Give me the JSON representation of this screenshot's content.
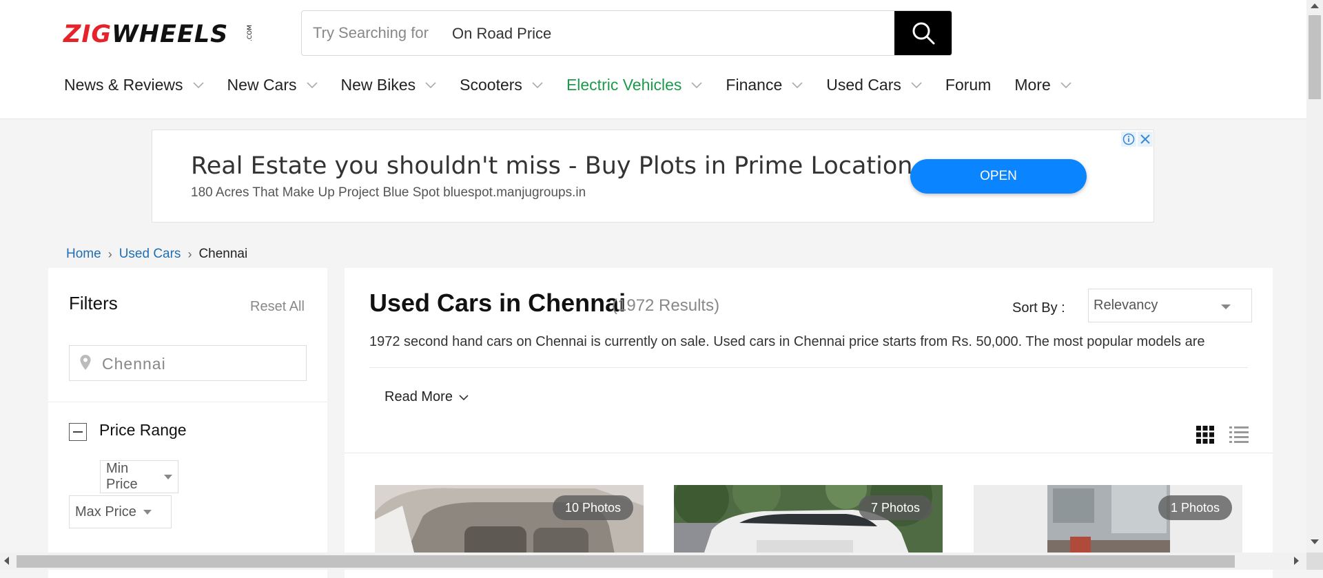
{
  "brand": {
    "logo_part1": "ZIG",
    "logo_part2": "WHEELS",
    "logo_suffix": ".COM",
    "red": "#e4232a"
  },
  "search": {
    "placeholder": "Try Searching for",
    "value": "On Road Price",
    "icon": "search-icon"
  },
  "nav": {
    "items": [
      {
        "label": "News & Reviews",
        "dropdown": true
      },
      {
        "label": "New Cars",
        "dropdown": true
      },
      {
        "label": "New Bikes",
        "dropdown": true
      },
      {
        "label": "Scooters",
        "dropdown": true
      },
      {
        "label": "Electric Vehicles",
        "dropdown": true,
        "color": "#1c9a4a"
      },
      {
        "label": "Finance",
        "dropdown": true
      },
      {
        "label": "Used Cars",
        "dropdown": true
      },
      {
        "label": "Forum",
        "dropdown": false
      },
      {
        "label": "More",
        "dropdown": true
      }
    ]
  },
  "ad": {
    "title": "Real Estate you shouldn't miss - Buy Plots in Prime Location",
    "subtitle": "180 Acres That Make Up Project Blue Spot bluespot.manjugroups.in",
    "button": "OPEN",
    "button_color": "#0a84ff"
  },
  "breadcrumb": {
    "home": "Home",
    "used": "Used Cars",
    "current": "Chennai"
  },
  "filters": {
    "title": "Filters",
    "reset": "Reset All",
    "city": "Chennai",
    "price_range": "Price Range",
    "min_price": "Min Price",
    "max_price": "Max Price"
  },
  "main": {
    "title": "Used Cars in Chennai",
    "count": "(1972 Results)",
    "sort_label": "Sort By :",
    "sort_value": "Relevancy",
    "description": "1972 second hand cars on Chennai is currently on sale. Used cars in Chennai price starts from Rs. 50,000. The most popular models are",
    "read_more": "Read More",
    "cards": [
      {
        "photos": "10 Photos"
      },
      {
        "photos": "7 Photos"
      },
      {
        "photos": "1 Photos"
      }
    ]
  }
}
